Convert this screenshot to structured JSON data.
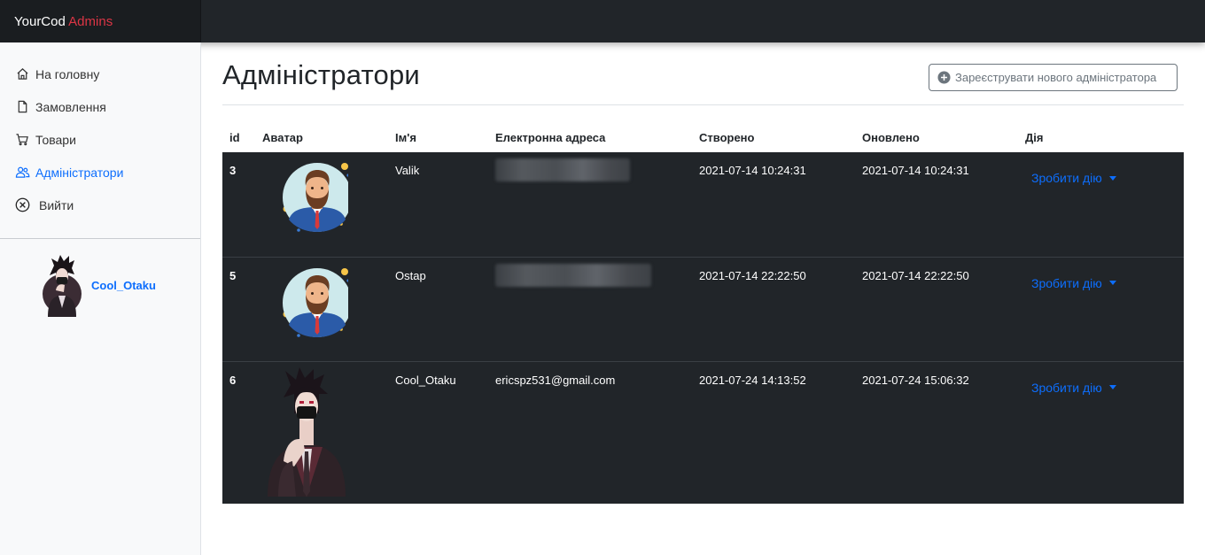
{
  "brand": {
    "name": "YourCod",
    "accent": "Admins",
    "accent_color": "#dc3545"
  },
  "sidebar": {
    "items": [
      {
        "label": "На головну",
        "icon": "home-icon"
      },
      {
        "label": "Замовлення",
        "icon": "file-icon"
      },
      {
        "label": "Товари",
        "icon": "cart-icon"
      },
      {
        "label": "Адміністратори",
        "icon": "people-icon",
        "active": true
      },
      {
        "label": "Вийти",
        "icon": "x-circle-icon"
      }
    ],
    "user": {
      "name": "Cool_Otaku"
    }
  },
  "page": {
    "title": "Адміністратори",
    "register_button": "Зареєструвати нового адміністратора"
  },
  "table": {
    "headers": [
      "id",
      "Аватар",
      "Ім'я",
      "Електронна адреса",
      "Створено",
      "Оновлено",
      "Дія"
    ],
    "rows": [
      {
        "id": "3",
        "avatar": "bearded-man-avatar",
        "name": "Valik",
        "email": "",
        "email_blurred": true,
        "created": "2021-07-14 10:24:31",
        "updated": "2021-07-14 10:24:31",
        "action": "Зробити дію"
      },
      {
        "id": "5",
        "avatar": "bearded-man-avatar",
        "name": "Ostap",
        "email": "",
        "email_blurred": true,
        "created": "2021-07-14 22:22:50",
        "updated": "2021-07-14 22:22:50",
        "action": "Зробити дію"
      },
      {
        "id": "6",
        "avatar": "anime-character-avatar",
        "name": "Cool_Otaku",
        "email": "ericspz531@gmail.com",
        "email_blurred": false,
        "created": "2021-07-24 14:13:52",
        "updated": "2021-07-24 15:06:32",
        "action": "Зробити дію"
      }
    ]
  },
  "colors": {
    "primary": "#0d6efd",
    "dark": "#212529",
    "topbar": "#212529"
  }
}
